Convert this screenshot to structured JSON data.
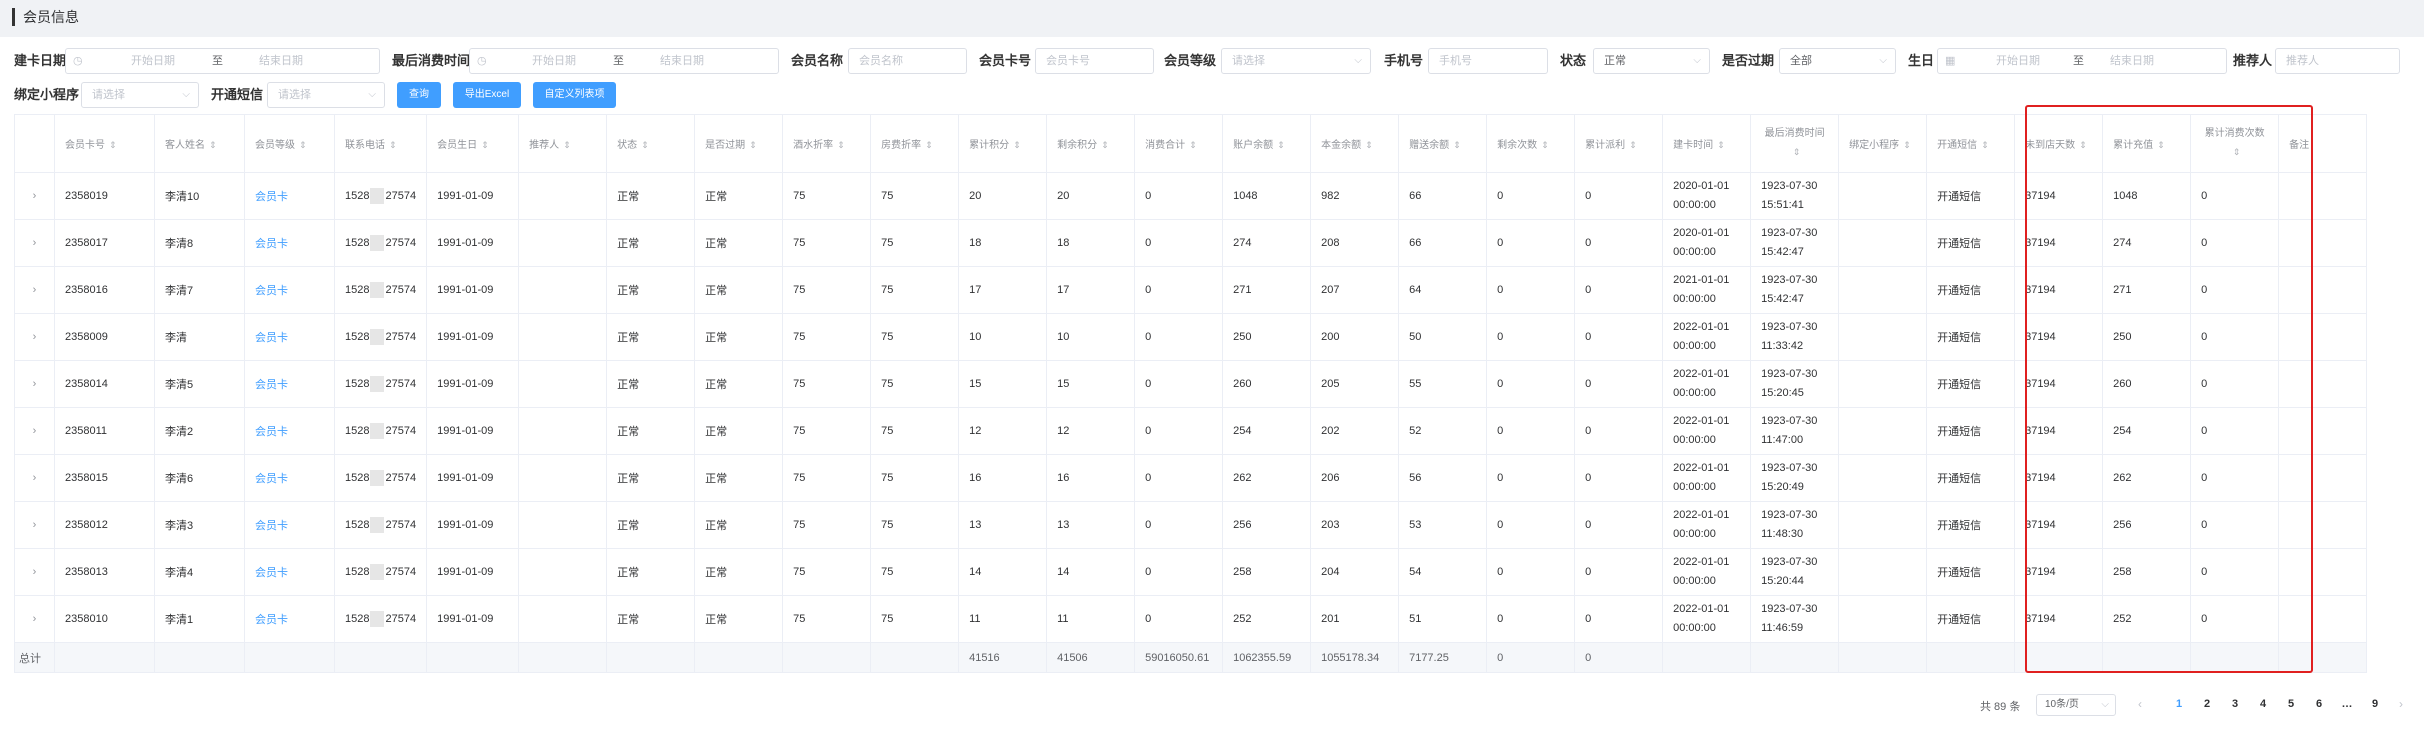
{
  "page_title": "会员信息",
  "filters": {
    "card_date": {
      "label": "建卡日期",
      "start": "开始日期",
      "sep": "至",
      "end": "结束日期"
    },
    "last_consume": {
      "label": "最后消费时间",
      "start": "开始日期",
      "sep": "至",
      "end": "结束日期"
    },
    "member_name": {
      "label": "会员名称",
      "placeholder": "会员名称"
    },
    "card_no": {
      "label": "会员卡号",
      "placeholder": "会员卡号"
    },
    "level": {
      "label": "会员等级",
      "placeholder": "请选择"
    },
    "phone": {
      "label": "手机号",
      "placeholder": "手机号"
    },
    "status": {
      "label": "状态",
      "value": "正常"
    },
    "expired": {
      "label": "是否过期",
      "value": "全部"
    },
    "birthday": {
      "label": "生日",
      "start": "开始日期",
      "sep": "至",
      "end": "结束日期"
    },
    "referrer": {
      "label": "推荐人",
      "placeholder": "推荐人"
    },
    "mini_program": {
      "label": "绑定小程序",
      "placeholder": "请选择"
    },
    "sms": {
      "label": "开通短信",
      "placeholder": "请选择"
    }
  },
  "buttons": {
    "query": "查询",
    "export": "导出Excel",
    "custom": "自定义列表项"
  },
  "table": {
    "headers": [
      "会员卡号",
      "客人姓名",
      "会员等级",
      "联系电话",
      "会员生日",
      "推荐人",
      "状态",
      "是否过期",
      "酒水折率",
      "房费折率",
      "累计积分",
      "剩余积分",
      "消费合计",
      "账户余额",
      "本金余额",
      "赠送余额",
      "剩余次数",
      "累计派利",
      "建卡时间",
      "最后消费时间",
      "绑定小程序",
      "开通短信",
      "未到店天数",
      "累计充值",
      "累计消费次数",
      "备注"
    ],
    "expand_icon": "›",
    "rows": [
      [
        "2358019",
        "李清10",
        "会员卡",
        "1528",
        "27574",
        "1991-01-09",
        "",
        "正常",
        "正常",
        "75",
        "75",
        "20",
        "20",
        "0",
        "1048",
        "982",
        "66",
        "0",
        "0",
        "2020-01-01 00:00:00",
        "1923-07-30 15:51:41",
        "",
        "开通短信",
        "37194",
        "1048",
        "0",
        ""
      ],
      [
        "2358017",
        "李清8",
        "会员卡",
        "1528",
        "27574",
        "1991-01-09",
        "",
        "正常",
        "正常",
        "75",
        "75",
        "18",
        "18",
        "0",
        "274",
        "208",
        "66",
        "0",
        "0",
        "2020-01-01 00:00:00",
        "1923-07-30 15:42:47",
        "",
        "开通短信",
        "37194",
        "274",
        "0",
        ""
      ],
      [
        "2358016",
        "李清7",
        "会员卡",
        "1528",
        "27574",
        "1991-01-09",
        "",
        "正常",
        "正常",
        "75",
        "75",
        "17",
        "17",
        "0",
        "271",
        "207",
        "64",
        "0",
        "0",
        "2021-01-01 00:00:00",
        "1923-07-30 15:42:47",
        "",
        "开通短信",
        "37194",
        "271",
        "0",
        ""
      ],
      [
        "2358009",
        "李清",
        "会员卡",
        "1528",
        "27574",
        "1991-01-09",
        "",
        "正常",
        "正常",
        "75",
        "75",
        "10",
        "10",
        "0",
        "250",
        "200",
        "50",
        "0",
        "0",
        "2022-01-01 00:00:00",
        "1923-07-30 11:33:42",
        "",
        "开通短信",
        "37194",
        "250",
        "0",
        ""
      ],
      [
        "2358014",
        "李清5",
        "会员卡",
        "1528",
        "27574",
        "1991-01-09",
        "",
        "正常",
        "正常",
        "75",
        "75",
        "15",
        "15",
        "0",
        "260",
        "205",
        "55",
        "0",
        "0",
        "2022-01-01 00:00:00",
        "1923-07-30 15:20:45",
        "",
        "开通短信",
        "37194",
        "260",
        "0",
        ""
      ],
      [
        "2358011",
        "李清2",
        "会员卡",
        "1528",
        "27574",
        "1991-01-09",
        "",
        "正常",
        "正常",
        "75",
        "75",
        "12",
        "12",
        "0",
        "254",
        "202",
        "52",
        "0",
        "0",
        "2022-01-01 00:00:00",
        "1923-07-30 11:47:00",
        "",
        "开通短信",
        "37194",
        "254",
        "0",
        ""
      ],
      [
        "2358015",
        "李清6",
        "会员卡",
        "1528",
        "27574",
        "1991-01-09",
        "",
        "正常",
        "正常",
        "75",
        "75",
        "16",
        "16",
        "0",
        "262",
        "206",
        "56",
        "0",
        "0",
        "2022-01-01 00:00:00",
        "1923-07-30 15:20:49",
        "",
        "开通短信",
        "37194",
        "262",
        "0",
        ""
      ],
      [
        "2358012",
        "李清3",
        "会员卡",
        "1528",
        "27574",
        "1991-01-09",
        "",
        "正常",
        "正常",
        "75",
        "75",
        "13",
        "13",
        "0",
        "256",
        "203",
        "53",
        "0",
        "0",
        "2022-01-01 00:00:00",
        "1923-07-30 11:48:30",
        "",
        "开通短信",
        "37194",
        "256",
        "0",
        ""
      ],
      [
        "2358013",
        "李清4",
        "会员卡",
        "1528",
        "27574",
        "1991-01-09",
        "",
        "正常",
        "正常",
        "75",
        "75",
        "14",
        "14",
        "0",
        "258",
        "204",
        "54",
        "0",
        "0",
        "2022-01-01 00:00:00",
        "1923-07-30 15:20:44",
        "",
        "开通短信",
        "37194",
        "258",
        "0",
        ""
      ],
      [
        "2358010",
        "李清1",
        "会员卡",
        "1528",
        "27574",
        "1991-01-09",
        "",
        "正常",
        "正常",
        "75",
        "75",
        "11",
        "11",
        "0",
        "252",
        "201",
        "51",
        "0",
        "0",
        "2022-01-01 00:00:00",
        "1923-07-30 11:46:59",
        "",
        "开通短信",
        "37194",
        "252",
        "0",
        ""
      ]
    ],
    "summary": {
      "label": "总计",
      "累计积分": "41516",
      "剩余积分": "41506",
      "消费合计": "59016050.61",
      "账户余额": "1062355.59",
      "本金余额": "1055178.34",
      "赠送余额": "7177.25",
      "剩余次数": "0",
      "累计派利": "0"
    }
  },
  "pagination": {
    "total_text": "共 89 条",
    "page_size": "10条/页",
    "pages": [
      "1",
      "2",
      "3",
      "4",
      "5",
      "6",
      "…",
      "9"
    ],
    "current": "1",
    "prev": "‹",
    "next": "›"
  }
}
